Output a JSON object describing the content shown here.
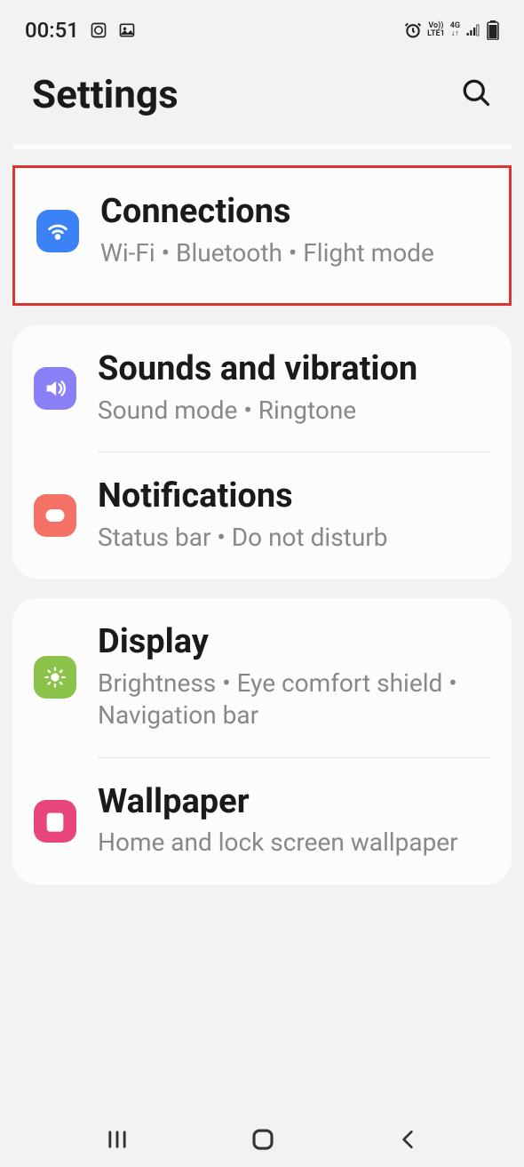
{
  "status": {
    "time": "00:51"
  },
  "header": {
    "title": "Settings"
  },
  "groups": [
    {
      "highlighted": true,
      "items": [
        {
          "icon": "wifi",
          "title": "Connections",
          "subtitle": "Wi-Fi  •  Bluetooth  •  Flight mode"
        }
      ]
    },
    {
      "highlighted": false,
      "items": [
        {
          "icon": "sound",
          "title": "Sounds and vibration",
          "subtitle": "Sound mode  •  Ringtone"
        },
        {
          "icon": "notifications",
          "title": "Notifications",
          "subtitle": "Status bar  •  Do not disturb"
        }
      ]
    },
    {
      "highlighted": false,
      "items": [
        {
          "icon": "display",
          "title": "Display",
          "subtitle": "Brightness  •  Eye comfort shield  •  Navigation bar"
        },
        {
          "icon": "wallpaper",
          "title": "Wallpaper",
          "subtitle": "Home and lock screen wallpaper"
        }
      ]
    }
  ]
}
